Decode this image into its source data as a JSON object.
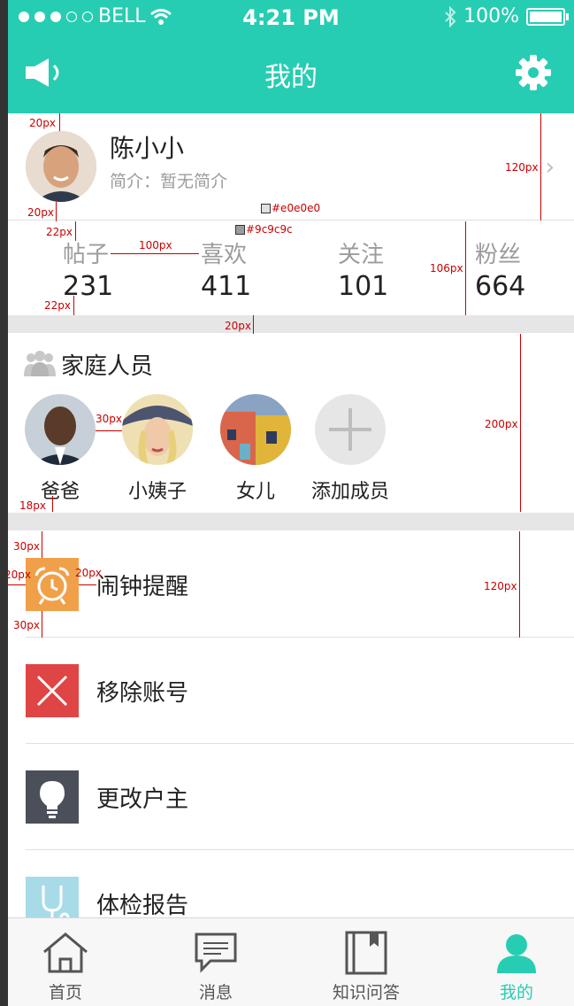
{
  "status_bar": {
    "carrier": "BELL",
    "time": "4:21 PM",
    "battery": "100%"
  },
  "header": {
    "title": "我的",
    "left_icon": "speaker-icon",
    "right_icon": "gear-icon"
  },
  "profile": {
    "name": "陈小小",
    "bio": "简介：暂无简介"
  },
  "stats": [
    {
      "label": "帖子",
      "value": "231"
    },
    {
      "label": "喜欢",
      "value": "411"
    },
    {
      "label": "关注",
      "value": "101"
    },
    {
      "label": "粉丝",
      "value": "664"
    }
  ],
  "family": {
    "title": "家庭人员",
    "members": [
      {
        "name": "爸爸"
      },
      {
        "name": "小姨子"
      },
      {
        "name": "女儿"
      },
      {
        "name": "添加成员"
      }
    ]
  },
  "menu": [
    {
      "label": "闹钟提醒",
      "icon": "alarm-clock-icon",
      "color": "#f1a04a"
    },
    {
      "label": "移除账号",
      "icon": "close-icon",
      "color": "#e04545"
    },
    {
      "label": "更改户主",
      "icon": "lightbulb-icon",
      "color": "#4b4f5a"
    },
    {
      "label": "体检报告",
      "icon": "stethoscope-icon",
      "color": "#a8dbe8"
    }
  ],
  "tabs": [
    {
      "label": "首页",
      "icon": "home-icon"
    },
    {
      "label": "消息",
      "icon": "message-icon"
    },
    {
      "label": "知识问答",
      "icon": "book-icon"
    },
    {
      "label": "我的",
      "icon": "user-icon",
      "active": true
    }
  ],
  "annotations": {
    "m20a": "20px",
    "m20b": "20px",
    "m22a": "22px",
    "m22b": "22px",
    "m100": "100px",
    "m120a": "120px",
    "m106": "106px",
    "m20c": "20px",
    "m30a": "30px",
    "m200": "200px",
    "m18": "18px",
    "m30b": "30px",
    "m30c": "30px",
    "m20d": "20px",
    "m20e": "20px",
    "m120b": "120px",
    "c1": "#e0e0e0",
    "c2": "#9c9c9c"
  },
  "colors": {
    "accent": "#27cdb2",
    "divider": "#e0e0e0",
    "muted_text": "#9c9c9c"
  }
}
